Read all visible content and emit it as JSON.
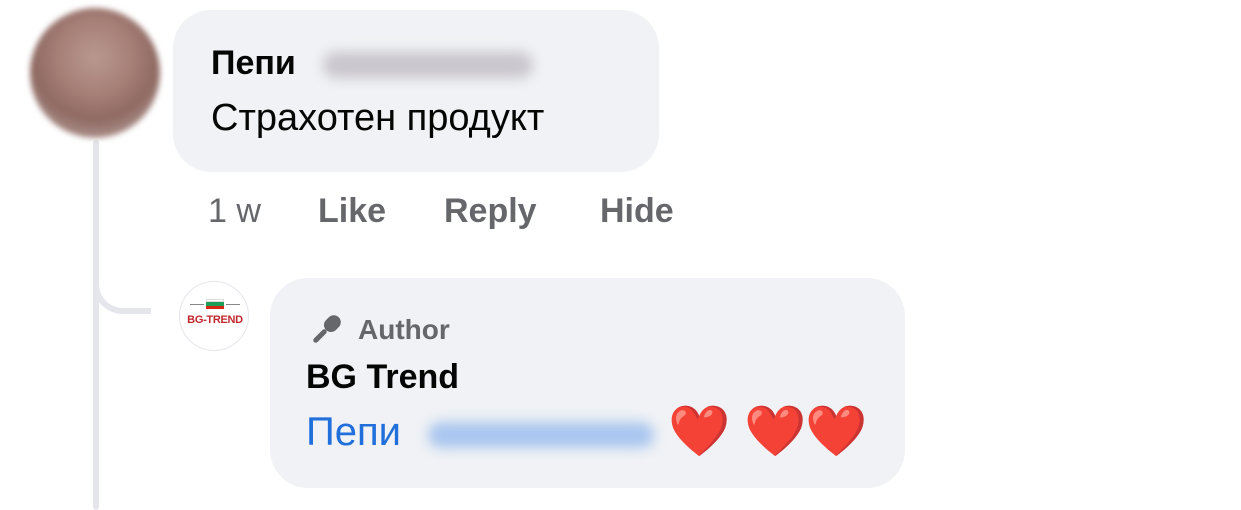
{
  "comment": {
    "author": "Пепи",
    "text": "Страхотен продукт",
    "time": "1 w",
    "actions": {
      "like": "Like",
      "reply": "Reply",
      "hide": "Hide"
    }
  },
  "reply": {
    "badge": "Author",
    "author": "BG Trend",
    "mention": "Пепи",
    "reactions": [
      "❤️",
      "❤️",
      "❤️"
    ],
    "logo_text": "BG-TREND"
  },
  "colors": {
    "bubble": "#f0f2f5",
    "secondary_text": "#65676b",
    "mention": "#216fdb",
    "heart": "#e0142c"
  },
  "icons": {
    "badge_icon": "microphone-icon"
  }
}
